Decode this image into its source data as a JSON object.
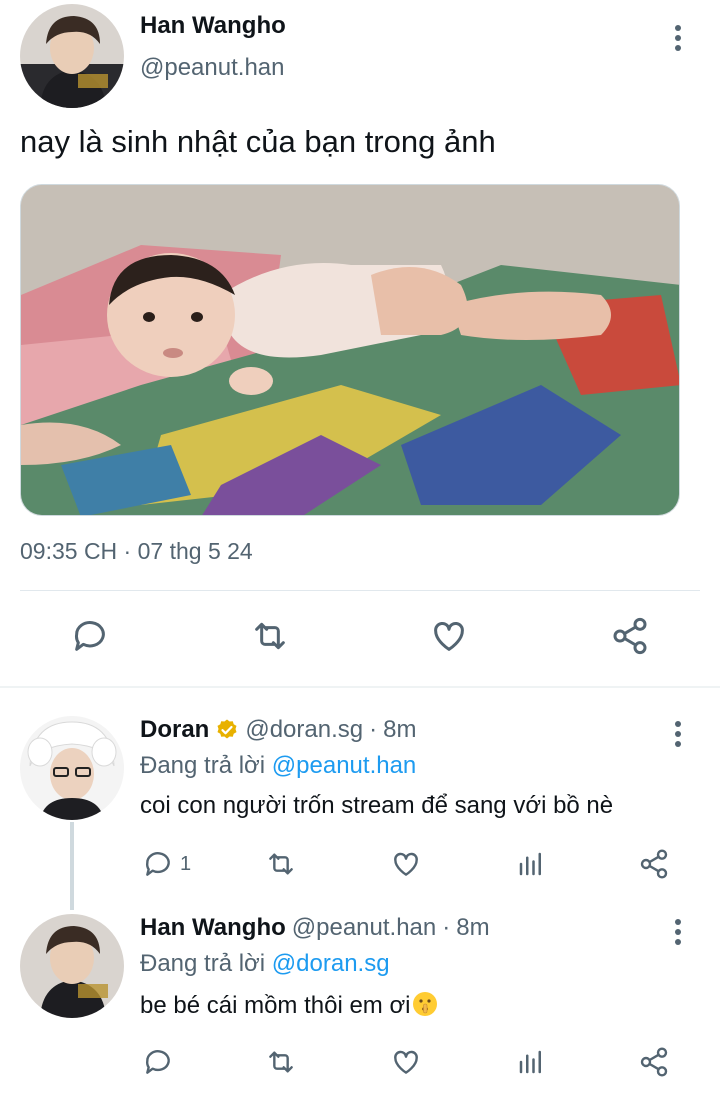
{
  "main_tweet": {
    "author_name": "Han Wangho",
    "author_handle": "@peanut.han",
    "text": "nay là sinh nhật của bạn trong ảnh",
    "timestamp": "09:35 CH · 07 thg 5 24",
    "actions": [
      "reply-icon",
      "retweet-icon",
      "like-icon",
      "share-icon"
    ]
  },
  "replies": [
    {
      "author_name": "Doran",
      "verified": true,
      "author_handle": "@doran.sg",
      "separator": "·",
      "time": "8m",
      "replying_prefix": "Đang trả lời",
      "replying_to": "@peanut.han",
      "text": "coi con người trốn stream để sang với bồ nè",
      "reply_count": "1"
    },
    {
      "author_name": "Han Wangho",
      "verified": false,
      "author_handle": "@peanut.han",
      "separator": "·",
      "time": "8m",
      "replying_prefix": "Đang trả lời",
      "replying_to": "@doran.sg",
      "text": "be bé cái mồm thôi em ơi",
      "emoji": "shushing-face-icon",
      "reply_count": ""
    }
  ],
  "colors": {
    "text": "#0f1419",
    "secondary": "#536471",
    "link": "#1d9bf0",
    "verified": "#e8b100",
    "divider": "#eff3f4"
  }
}
